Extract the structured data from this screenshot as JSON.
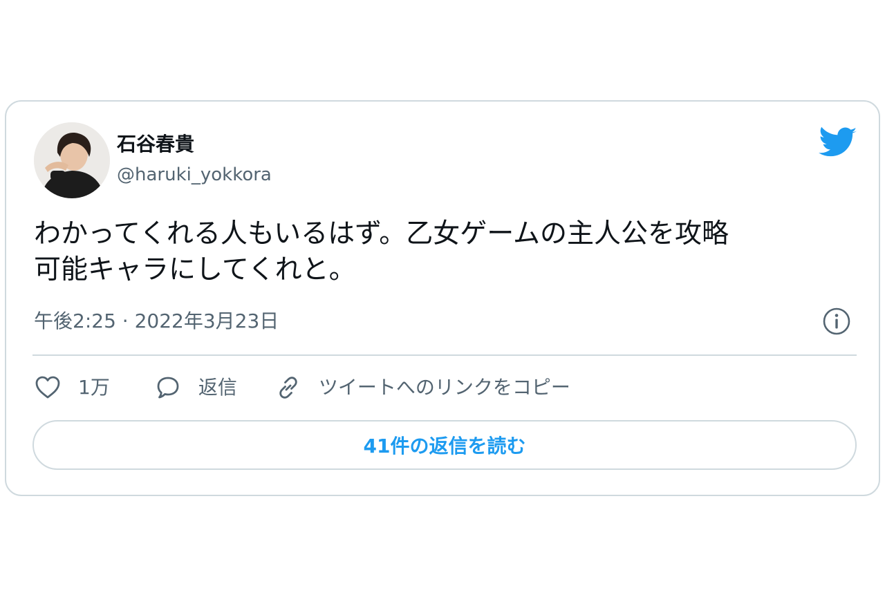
{
  "author": {
    "display_name": "石谷春貴",
    "handle": "@haruki_yokkora"
  },
  "tweet": {
    "text_line1": "わかってくれる人もいるはず。乙女ゲームの主人公を攻略",
    "text_line2": "可能キャラにしてくれと。",
    "timestamp": "午後2:25 · 2022年3月23日"
  },
  "actions": {
    "like_count": "1万",
    "reply_label": "返信",
    "copy_link_label": "ツイートへのリンクをコピー"
  },
  "read_replies_label": "41件の返信を読む",
  "icons": {
    "brand": "twitter-bird-icon",
    "info": "info-icon",
    "like": "heart-icon",
    "reply": "speech-bubble-icon",
    "link": "link-icon"
  },
  "colors": {
    "brand_blue": "#1d9bf0",
    "text_primary": "#0f1419",
    "text_secondary": "#536471",
    "border": "#cfd9de"
  }
}
